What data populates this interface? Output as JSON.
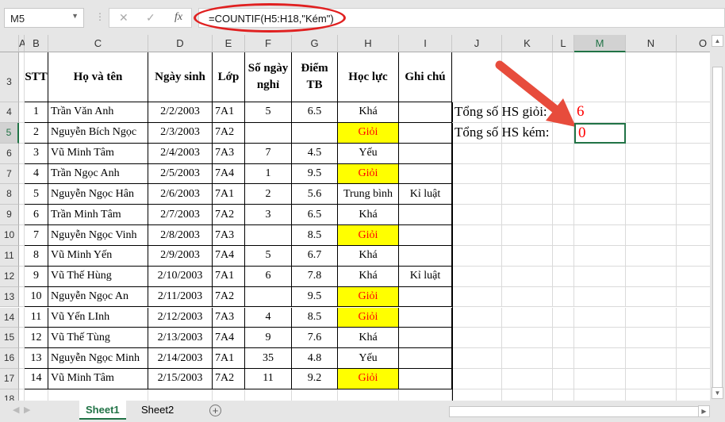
{
  "name_box": "M5",
  "formula": "=COUNTIF(H5:H18,\"Kém\")",
  "fx_label": "fx",
  "columns": [
    "A",
    "B",
    "C",
    "D",
    "E",
    "F",
    "G",
    "H",
    "I",
    "J",
    "K",
    "L",
    "M",
    "N",
    "O"
  ],
  "header_row": {
    "row": "3",
    "stt": "STT",
    "name": "Họ và tên",
    "dob": "Ngày sinh",
    "class": "Lớp",
    "absent": "Số ngày nghỉ",
    "score": "Điểm TB",
    "rank": "Học lực",
    "note": "Ghi chú"
  },
  "rows": [
    {
      "row": "4",
      "stt": "1",
      "name": "Trần Văn Anh",
      "dob": "2/2/2003",
      "class": "7A1",
      "absent": "5",
      "score": "6.5",
      "rank": "Khá",
      "note": ""
    },
    {
      "row": "5",
      "stt": "2",
      "name": "Nguyễn Bích Ngọc",
      "dob": "2/3/2003",
      "class": "7A2",
      "absent": "",
      "score": "",
      "rank": "Giỏi",
      "note": ""
    },
    {
      "row": "6",
      "stt": "3",
      "name": "Vũ Minh Tâm",
      "dob": "2/4/2003",
      "class": "7A3",
      "absent": "7",
      "score": "4.5",
      "rank": "Yếu",
      "note": ""
    },
    {
      "row": "7",
      "stt": "4",
      "name": "Trần Ngọc Anh",
      "dob": "2/5/2003",
      "class": "7A4",
      "absent": "1",
      "score": "9.5",
      "rank": "Giỏi",
      "note": ""
    },
    {
      "row": "8",
      "stt": "5",
      "name": "Nguyễn Ngọc Hân",
      "dob": "2/6/2003",
      "class": "7A1",
      "absent": "2",
      "score": "5.6",
      "rank": "Trung bình",
      "note": "Kỉ luật"
    },
    {
      "row": "9",
      "stt": "6",
      "name": "Trần Minh Tâm",
      "dob": "2/7/2003",
      "class": "7A2",
      "absent": "3",
      "score": "6.5",
      "rank": "Khá",
      "note": ""
    },
    {
      "row": "10",
      "stt": "7",
      "name": "Nguyễn Ngọc Vinh",
      "dob": "2/8/2003",
      "class": "7A3",
      "absent": "",
      "score": "8.5",
      "rank": "Giỏi",
      "note": ""
    },
    {
      "row": "11",
      "stt": "8",
      "name": "Vũ Minh Yến",
      "dob": "2/9/2003",
      "class": "7A4",
      "absent": "5",
      "score": "6.7",
      "rank": "Khá",
      "note": ""
    },
    {
      "row": "12",
      "stt": "9",
      "name": "Vũ Thế Hùng",
      "dob": "2/10/2003",
      "class": "7A1",
      "absent": "6",
      "score": "7.8",
      "rank": "Khá",
      "note": "Kỉ luật"
    },
    {
      "row": "13",
      "stt": "10",
      "name": "Nguyễn Ngọc An",
      "dob": "2/11/2003",
      "class": "7A2",
      "absent": "",
      "score": "9.5",
      "rank": "Giỏi",
      "note": ""
    },
    {
      "row": "14",
      "stt": "11",
      "name": "Vũ  Yến LInh",
      "dob": "2/12/2003",
      "class": "7A3",
      "absent": "4",
      "score": "8.5",
      "rank": "Giỏi",
      "note": ""
    },
    {
      "row": "15",
      "stt": "12",
      "name": "Vũ Thế Tùng",
      "dob": "2/13/2003",
      "class": "7A4",
      "absent": "9",
      "score": "7.6",
      "rank": "Khá",
      "note": ""
    },
    {
      "row": "16",
      "stt": "13",
      "name": "Nguyễn Ngọc Minh",
      "dob": "2/14/2003",
      "class": "7A1",
      "absent": "35",
      "score": "4.8",
      "rank": "Yếu",
      "note": ""
    },
    {
      "row": "17",
      "stt": "14",
      "name": "Vũ Minh Tâm",
      "dob": "2/15/2003",
      "class": "7A2",
      "absent": "11",
      "score": "9.2",
      "rank": "Giỏi",
      "note": ""
    }
  ],
  "last_row": "18",
  "summary": {
    "good_label": "Tổng số HS giỏi:",
    "good_value": "6",
    "weak_label": "Tổng số HS kém:",
    "weak_value": "0"
  },
  "highlight_rank": "Giỏi",
  "colors": {
    "accent": "#217346",
    "highlight": "#ffff00",
    "red": "#ff0000",
    "arrow": "#e74c3c"
  },
  "sheets": [
    "Sheet1",
    "Sheet2"
  ],
  "active_sheet": "Sheet1"
}
